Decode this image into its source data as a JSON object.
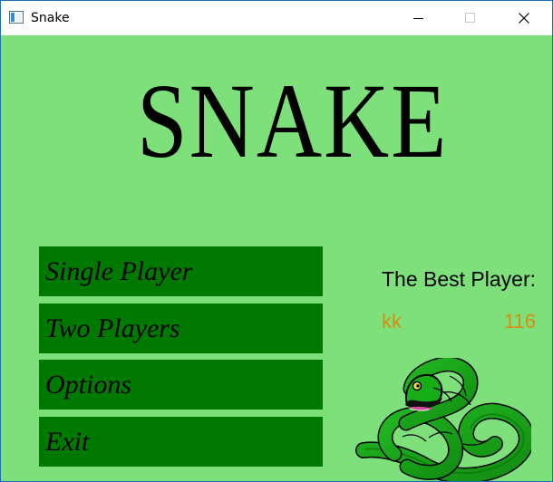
{
  "window": {
    "title": "Snake",
    "icon": "app-window-icon",
    "controls": {
      "minimize": "minimize-icon",
      "maximize": "maximize-icon",
      "close": "close-icon"
    }
  },
  "colors": {
    "background": "#7ee07b",
    "button": "#007900",
    "best_text": "#d98c12",
    "snake": "#15a315"
  },
  "game": {
    "title": "SNAKE"
  },
  "menu": {
    "single_player": "Single Player",
    "two_players": "Two Players",
    "options": "Options",
    "exit": "Exit"
  },
  "best": {
    "title": "The Best Player:",
    "name": "kk",
    "score": "116"
  },
  "image": {
    "icon": "snake-illustration"
  }
}
